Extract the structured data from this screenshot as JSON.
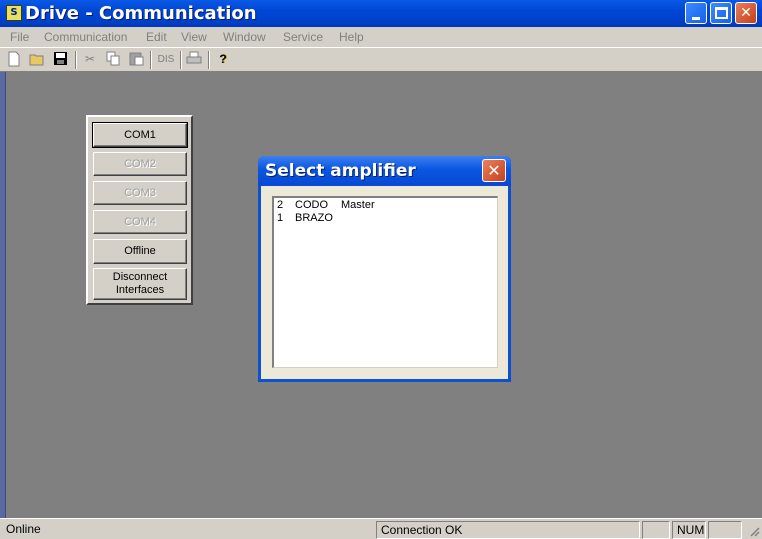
{
  "window": {
    "app_icon_text": "S",
    "title": "Drive - Communication"
  },
  "menu": [
    "File",
    "Communication",
    "Edit",
    "View",
    "Window",
    "Service",
    "Help"
  ],
  "toolbar": {
    "dis_label": "DIS"
  },
  "com_panel": {
    "buttons": [
      {
        "label": "COM1",
        "enabled": true
      },
      {
        "label": "COM2",
        "enabled": false
      },
      {
        "label": "COM3",
        "enabled": false
      },
      {
        "label": "COM4",
        "enabled": false
      },
      {
        "label": "Offline",
        "enabled": true
      },
      {
        "label": "Disconnect\nInterfaces",
        "enabled": true
      }
    ]
  },
  "dialog": {
    "title": "Select amplifier",
    "items": [
      {
        "num": "2",
        "name": "CODO",
        "role": "Master"
      },
      {
        "num": "1",
        "name": "BRAZO",
        "role": ""
      }
    ]
  },
  "status": {
    "left": "Online",
    "middle": "Connection OK",
    "num": "NUM"
  },
  "colors": {
    "workspace": "#808080",
    "title_bar": "#0046d5",
    "close_button": "#c8401a"
  }
}
